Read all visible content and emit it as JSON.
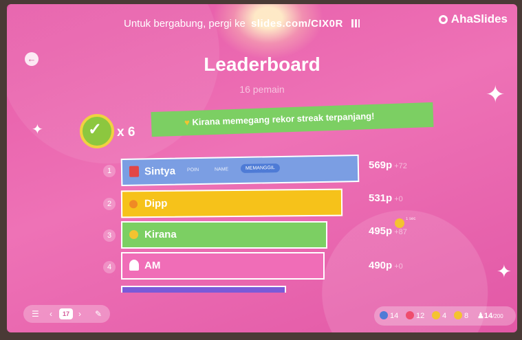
{
  "header": {
    "join_text": "Untuk bergabung, pergi ke",
    "join_code": "slides.com/CIX0R",
    "brand": "AhaSlides"
  },
  "title": "Leaderboard",
  "subtitle": "16 pemain",
  "streak": {
    "count": "x 6",
    "message": "Kirana memegang rekor streak terpanjang!"
  },
  "rows": [
    {
      "rank": "1",
      "name": "Sintya",
      "score": "569p",
      "delta": "+72",
      "color": "#7b9ee3",
      "chips": [
        "POIN",
        "NAME"
      ],
      "pill": "MEMANGGIL"
    },
    {
      "rank": "2",
      "name": "Dipp",
      "score": "531p",
      "delta": "+0",
      "color": "#f6c21a"
    },
    {
      "rank": "3",
      "name": "Kirana",
      "score": "495p",
      "delta": "+87",
      "color": "#7ccf63"
    },
    {
      "rank": "4",
      "name": "AM",
      "score": "490p",
      "delta": "+0",
      "color": "#f06db7"
    }
  ],
  "smiley_tag": "1 sec",
  "nav": {
    "page": "17"
  },
  "reactions": [
    {
      "icon": "thumbs-up-icon",
      "count": "14",
      "color": "#4e7bd6"
    },
    {
      "icon": "heart-icon",
      "count": "12",
      "color": "#ef4d6d"
    },
    {
      "icon": "laugh-icon",
      "count": "4",
      "color": "#f4c330"
    },
    {
      "icon": "wow-icon",
      "count": "8",
      "color": "#f4c330"
    },
    {
      "icon": "people-icon",
      "count": "14",
      "total": "/200"
    }
  ]
}
